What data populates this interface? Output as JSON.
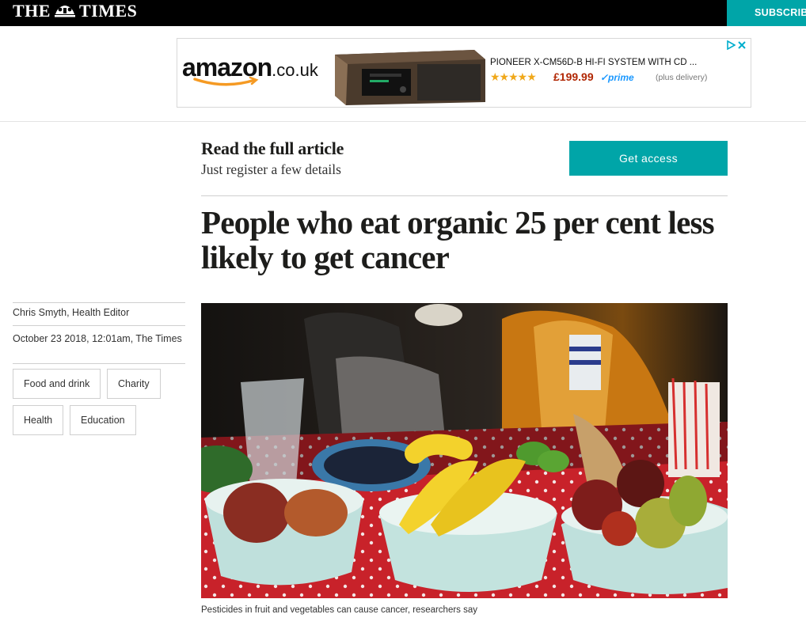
{
  "header": {
    "masthead_left": "THE",
    "masthead_right": "TIMES",
    "subscribe_label": "SUBSCRIBE"
  },
  "ad": {
    "logo_main": "amazon",
    "logo_suffix": ".co.uk",
    "product_title": "PIONEER X-CM56D-B HI-FI SYSTEM WITH CD ...",
    "rating_stars": "★★★★★",
    "price": "£199.99",
    "prime": "✓prime",
    "delivery": "(plus delivery)"
  },
  "paywall": {
    "title": "Read the full article",
    "subtitle": "Just register a few details",
    "cta_label": "Get access"
  },
  "article": {
    "headline": "People who eat organic 25 per cent less likely to get cancer",
    "byline": "Chris Smyth, Health Editor",
    "date": "October 23 2018, 12:01am, The Times",
    "tags": [
      "Food and drink",
      "Charity",
      "Health",
      "Education"
    ],
    "caption": "Pesticides in fruit and vegetables can cause cancer, researchers say"
  },
  "colors": {
    "accent": "#00a5a8",
    "topbar": "#000000",
    "price": "#b12704"
  }
}
